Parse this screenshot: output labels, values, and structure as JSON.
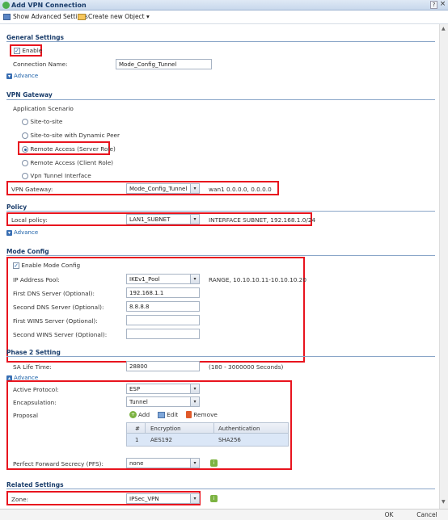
{
  "window": {
    "title": "Add VPN Connection",
    "help": "?",
    "close": "×"
  },
  "toolbar": {
    "show_advanced": "Show Advanced Settings",
    "create_new": "Create new Object ▾"
  },
  "general": {
    "title": "General Settings",
    "enable_label": "Enable",
    "enable_checked": true,
    "connection_name_label": "Connection Name:",
    "connection_name_value": "Mode_Config_Tunnel",
    "advance": "Advance"
  },
  "gateway": {
    "title": "VPN Gateway",
    "scenario_label": "Application Scenario",
    "options": [
      "Site-to-site",
      "Site-to-site with Dynamic Peer",
      "Remote Access (Server Role)",
      "Remote Access (Client Role)",
      "Vpn Tunnel Interface"
    ],
    "selected_index": 2,
    "vpn_gateway_label": "VPN Gateway:",
    "vpn_gateway_value": "Mode_Config_Tunnel",
    "vpn_gateway_info": "wan1  0.0.0.0, 0.0.0.0"
  },
  "policy": {
    "title": "Policy",
    "local_label": "Local policy:",
    "local_value": "LAN1_SUBNET",
    "local_info": "INTERFACE SUBNET, 192.168.1.0/24",
    "advance": "Advance"
  },
  "mode_config": {
    "title": "Mode Config",
    "enable_label": "Enable Mode Config",
    "ip_pool_label": "IP Address Pool:",
    "ip_pool_value": "IKEv1_Pool",
    "ip_pool_info": "RANGE, 10.10.10.11-10.10.10.20",
    "dns1_label": "First DNS Server (Optional):",
    "dns1_value": "192.168.1.1",
    "dns2_label": "Second DNS Server (Optional):",
    "dns2_value": "8.8.8.8",
    "wins1_label": "First WINS Server (Optional):",
    "wins1_value": "",
    "wins2_label": "Second WINS Server (Optional):",
    "wins2_value": ""
  },
  "phase2": {
    "title": "Phase 2 Setting",
    "sa_label": "SA Life Time:",
    "sa_value": "28800",
    "sa_hint": "(180 - 3000000 Seconds)",
    "advance": "Advance",
    "protocol_label": "Active Protocol:",
    "protocol_value": "ESP",
    "encap_label": "Encapsulation:",
    "encap_value": "Tunnel",
    "proposal_label": "Proposal",
    "add": "Add",
    "edit": "Edit",
    "remove": "Remove",
    "col_num": "#",
    "col_enc": "Encryption",
    "col_auth": "Authentication",
    "row_num": "1",
    "row_enc": "AES192",
    "row_auth": "SHA256",
    "pfs_label": "Perfect Forward Secrecy (PFS):",
    "pfs_value": "none"
  },
  "related": {
    "title": "Related Settings",
    "zone_label": "Zone:",
    "zone_value": "IPSec_VPN"
  },
  "footer": {
    "ok": "OK",
    "cancel": "Cancel"
  }
}
